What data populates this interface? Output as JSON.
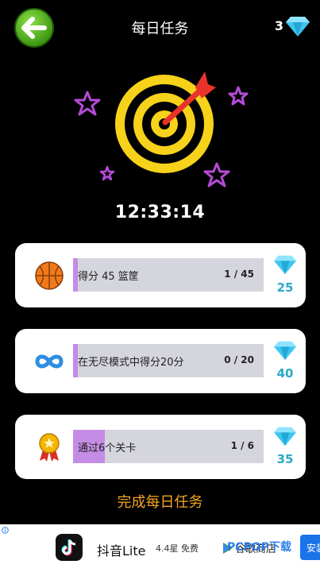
{
  "header": {
    "title": "每日任务",
    "gem_count": "3"
  },
  "timer": "12:33:14",
  "tasks": [
    {
      "label": "得分 45 篮筐",
      "count": "1 / 45",
      "progress": 0.022,
      "reward": "25",
      "icon": "basketball-icon"
    },
    {
      "label": "在无尽模式中得分20分",
      "count": "0 / 20",
      "progress": 0.0,
      "reward": "40",
      "icon": "infinity-icon"
    },
    {
      "label": "通过6个关卡",
      "count": "1 / 6",
      "progress": 0.167,
      "reward": "35",
      "icon": "medal-icon"
    }
  ],
  "complete_label": "完成每日任务",
  "ad": {
    "app_name": "抖音Lite",
    "rating": "4.4星 免费",
    "store": "谷歌商店",
    "install_label": "安装"
  },
  "watermark": "PCPOP下载",
  "colors": {
    "progress_fill": "#c58ce6",
    "progress_track": "#d4d5dd",
    "reward_text": "#2aa9c9",
    "complete_text": "#f5a623",
    "back_button": "#4caf1a",
    "target_yellow": "#f7d21a",
    "dart_red": "#e8332b",
    "stars": "#b44bd6"
  }
}
